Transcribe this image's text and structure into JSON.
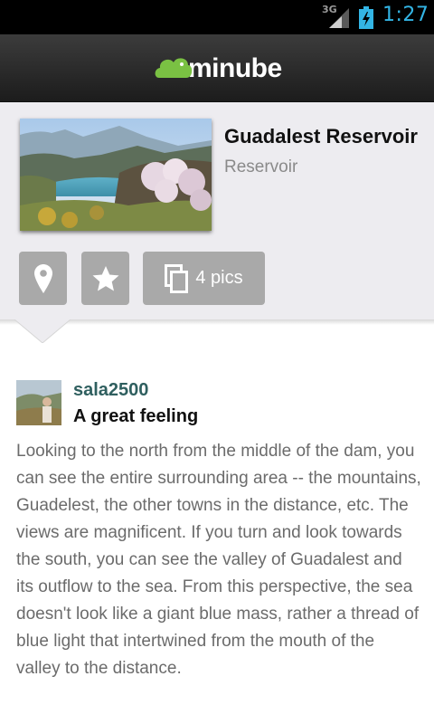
{
  "status_bar": {
    "network": "3G",
    "time": "1:27"
  },
  "app_bar": {
    "logo_text": "minube"
  },
  "place": {
    "title": "Guadalest Reservoir",
    "type": "Reservoir",
    "pics_label": "4 pics"
  },
  "review": {
    "username": "sala2500",
    "title": "A great feeling",
    "text": "Looking to the north from the middle of the dam, you can see the entire surrounding area -- the mountains, Guadelest, the other towns in the distance, etc. The views are magnificent. If you turn and look towards the south, you can see the valley of Guadalest and its outflow to the sea. From this perspective, the sea doesn't look like a giant blue mass, rather a thread of blue light that intertwined from the mouth of the valley to the distance."
  },
  "colors": {
    "accent_time": "#33b5e5",
    "logo_green": "#7ac143",
    "button_gray": "#a9a9a9",
    "username_color": "#2f5f5f"
  },
  "icons": [
    "location-pin-icon",
    "star-icon",
    "pictures-icon",
    "battery-charging-icon",
    "signal-icon"
  ]
}
